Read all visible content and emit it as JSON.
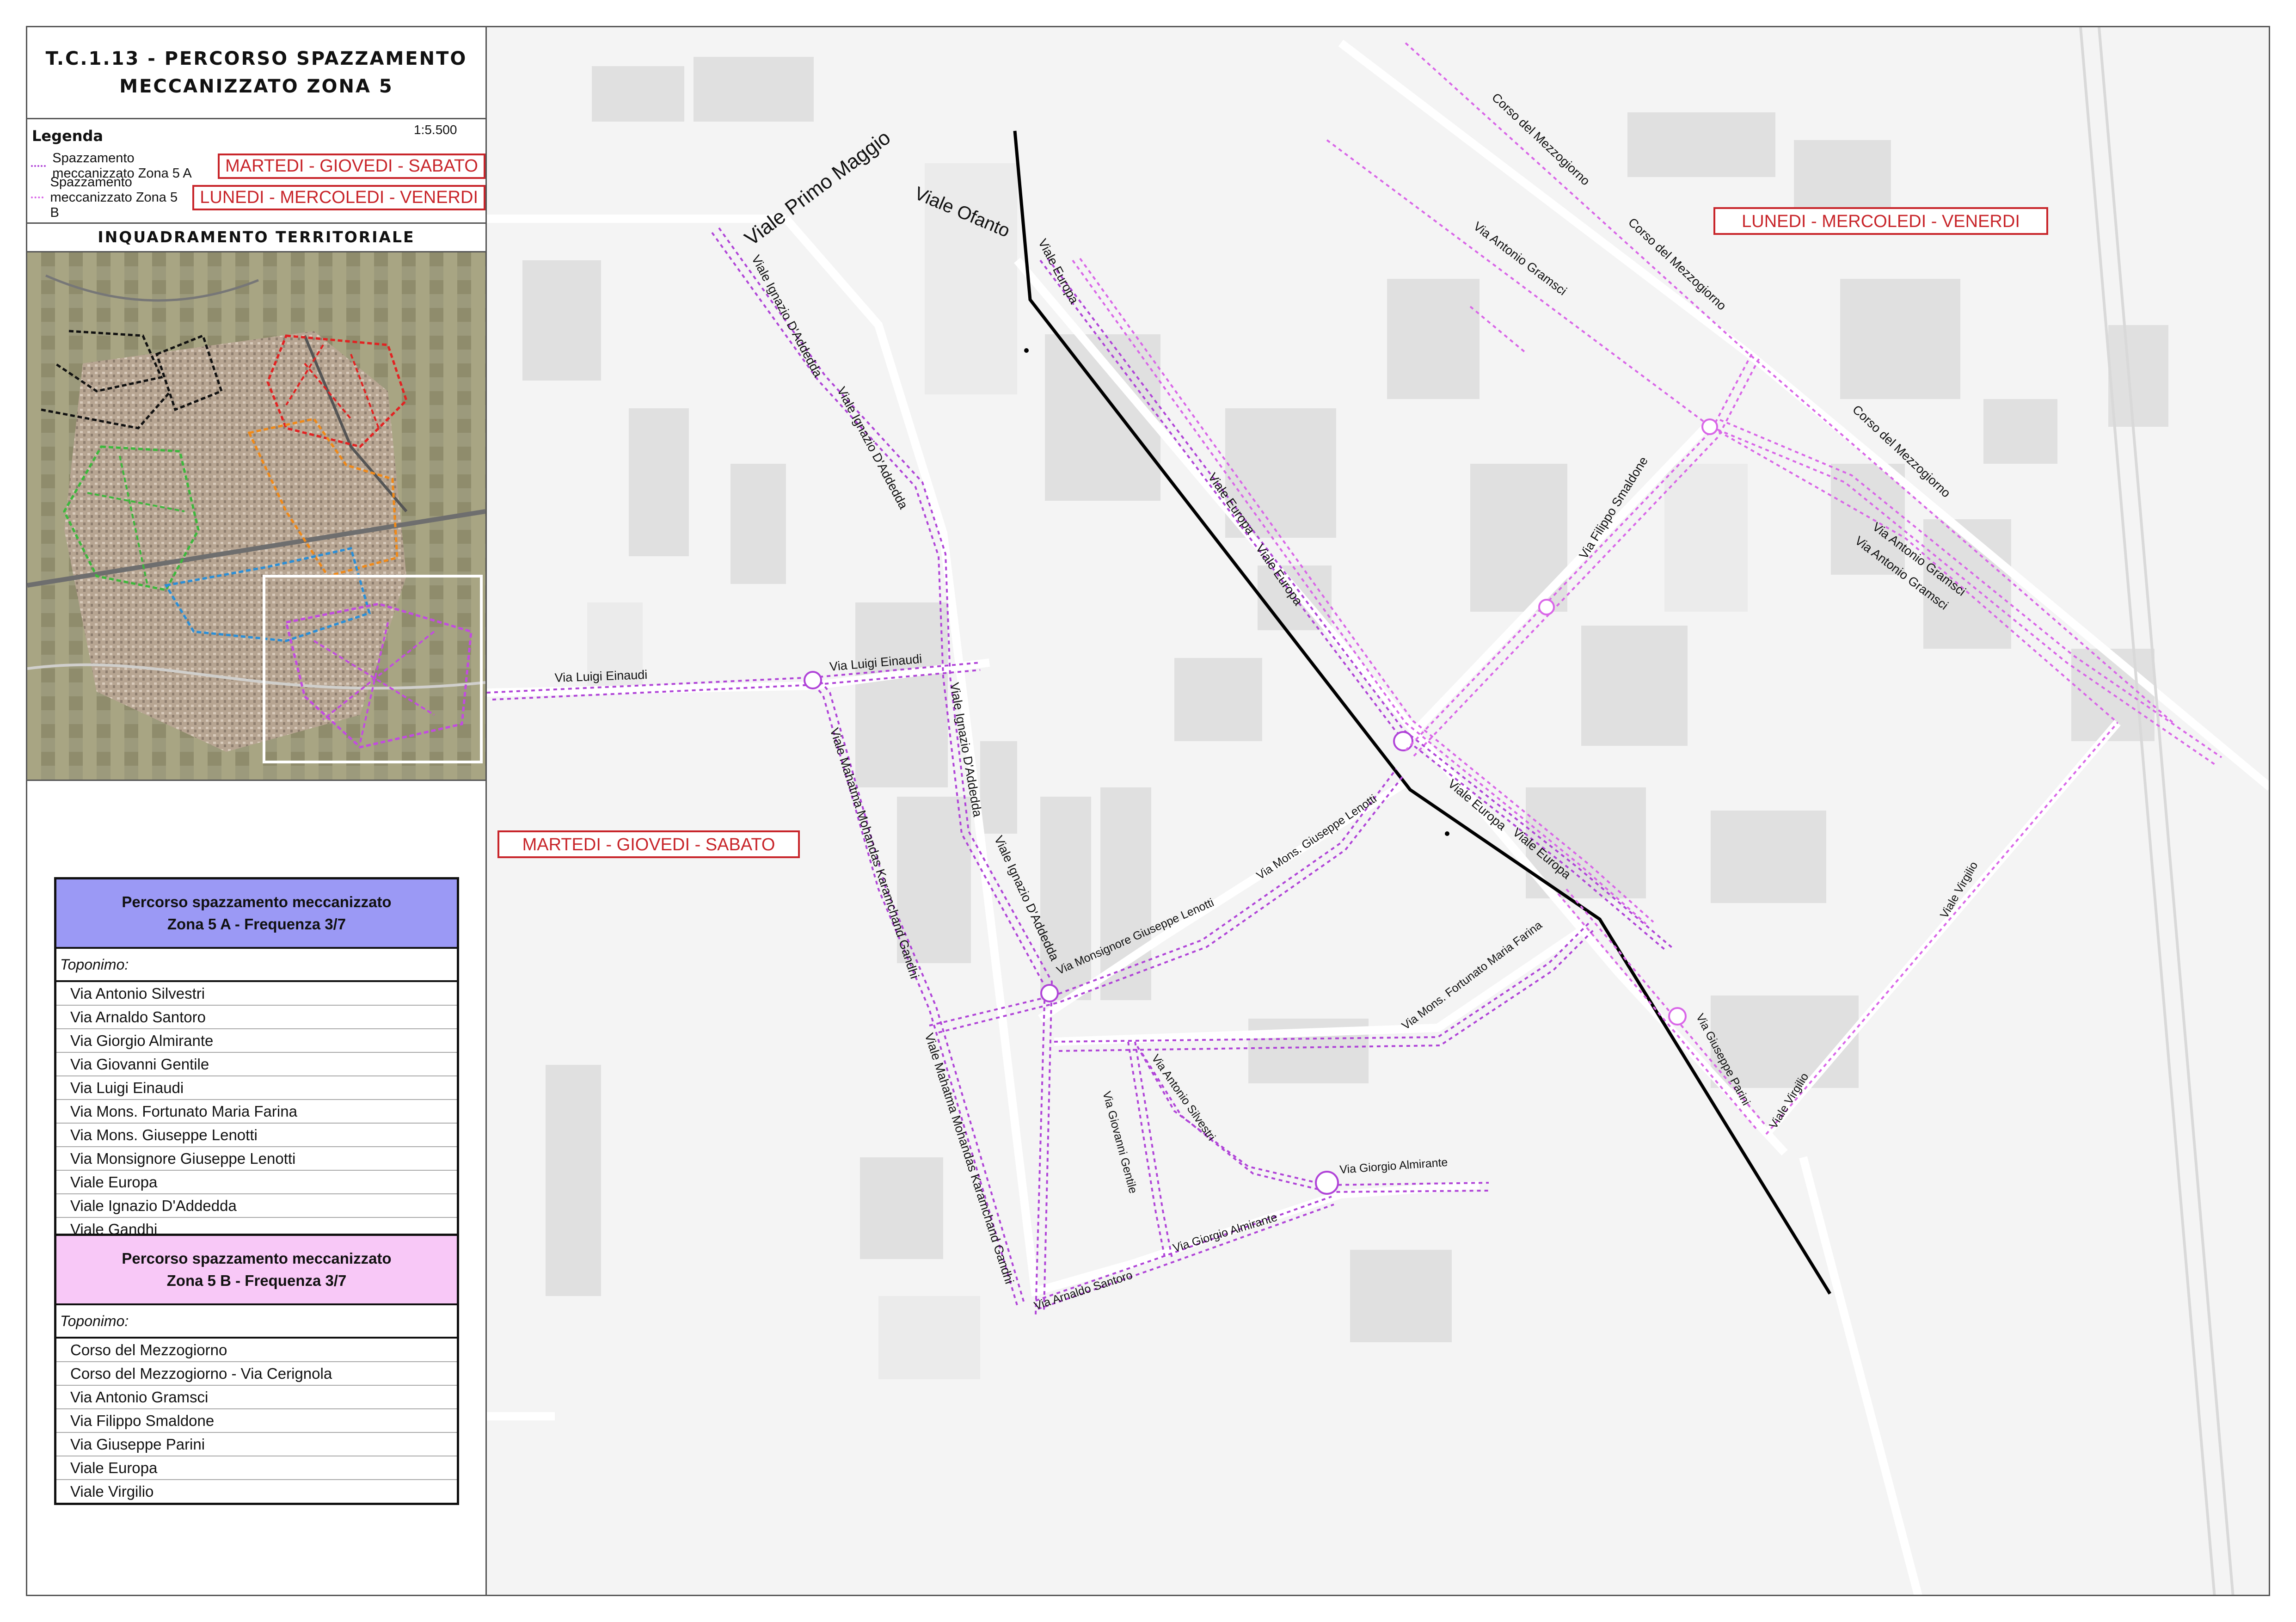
{
  "title": {
    "line1": "T.C.1.13 - PERCORSO SPAZZAMENTO",
    "line2": "MECCANIZZATO ZONA 5"
  },
  "legend": {
    "title": "Legenda",
    "scale": "1:5.500",
    "items": [
      {
        "label": "Spazzamento meccanizzato Zona 5 A",
        "days": "MARTEDI - GIOVEDI - SABATO",
        "color": "#b044d8"
      },
      {
        "label": "Spazzamento meccanizzato Zona 5 B",
        "days": "LUNEDI - MERCOLEDI - VENERDI",
        "color": "#d966e8"
      }
    ]
  },
  "inquadramento": {
    "title": "INQUADRAMENTO TERRITORIALE"
  },
  "table_a": {
    "heading1": "Percorso spazzamento  meccanizzato",
    "heading2": "Zona 5 A - Frequenza 3/7",
    "toponimo": "Toponimo:",
    "rows": [
      "Via Antonio Silvestri",
      "Via Arnaldo Santoro",
      "Via Giorgio Almirante",
      "Via Giovanni Gentile",
      "Via Luigi Einaudi",
      "Via Mons. Fortunato Maria Farina",
      "Via Mons. Giuseppe Lenotti",
      "Via Monsignore Giuseppe Lenotti",
      "Viale Europa",
      "Viale Ignazio D'Addedda",
      "Viale Gandhi"
    ]
  },
  "table_b": {
    "heading1": "Percorso spazzamento  meccanizzato",
    "heading2": "Zona 5 B - Frequenza 3/7",
    "toponimo": "Toponimo:",
    "rows": [
      "Corso del Mezzogiorno",
      "Corso del Mezzogiorno - Via Cerignola",
      "Via Antonio Gramsci",
      "Via Filippo Smaldone",
      "Via Giuseppe Parini",
      "Viale Europa",
      "Viale Virgilio"
    ]
  },
  "map": {
    "zone_a_days": "MARTEDI - GIOVEDI - SABATO",
    "zone_b_days": "LUNEDI - MERCOLEDI - VENERDI",
    "route_color_a": "#b044d8",
    "route_color_b": "#d966e8",
    "boundary_color": "#000000",
    "labels": {
      "viale_primo_maggio": "Viale Primo Maggio",
      "viale_ofanto": "Viale Ofanto",
      "viale_ignazio_1": "Viale Ignazio D'Addedda",
      "viale_ignazio_2": "Viale Ignazio D'Addedda",
      "viale_ignazio_3": "Viale Ignazio D'Addedda",
      "viale_ignazio_4": "Viale Ignazio D'Addedda",
      "viale_europa_1": "Viale Europa",
      "viale_europa_2": "Viale Europa",
      "viale_europa_3": "Viale Europa",
      "viale_europa_4": "Viale Europa",
      "viale_europa_5": "Viale Europa",
      "corso_mezz_1": "Corso del Mezzogiorno",
      "corso_mezz_2": "Corso del Mezzogiorno",
      "corso_mezz_3": "Corso del Mezzogiorno",
      "via_gramsci_1": "Via Antonio Gramsci",
      "via_gramsci_2": "Via Antonio Gramsci",
      "via_gramsci_3": "Via Antonio Gramsci",
      "via_smaldone": "Via Filippo Smaldone",
      "via_einaudi_1": "Via Luigi Einaudi",
      "via_einaudi_2": "Via Luigi Einaudi",
      "gandhi_1": "Viale Mahatma Mohandas Karamchand Gandhi",
      "gandhi_2": "Viale Mahatma Mohandas Karamchand Gandhi",
      "lenotti_mons": "Via Mons. Giuseppe Lenotti",
      "lenotti_monsignore": "Via Monsignore Giuseppe Lenotti",
      "farina": "Via Mons. Fortunato Maria Farina",
      "silvestri": "Via Antonio Silvestri",
      "gentile": "Via Giovanni Gentile",
      "almirante_1": "Via Giorgio Almirante",
      "almirante_2": "Via Giorgio Almirante",
      "santoro": "Via Arnaldo Santoro",
      "parini": "Via Giuseppe Parini",
      "virgilio_1": "Viale Virgilio",
      "virgilio_2": "Viale Virgilio"
    }
  }
}
